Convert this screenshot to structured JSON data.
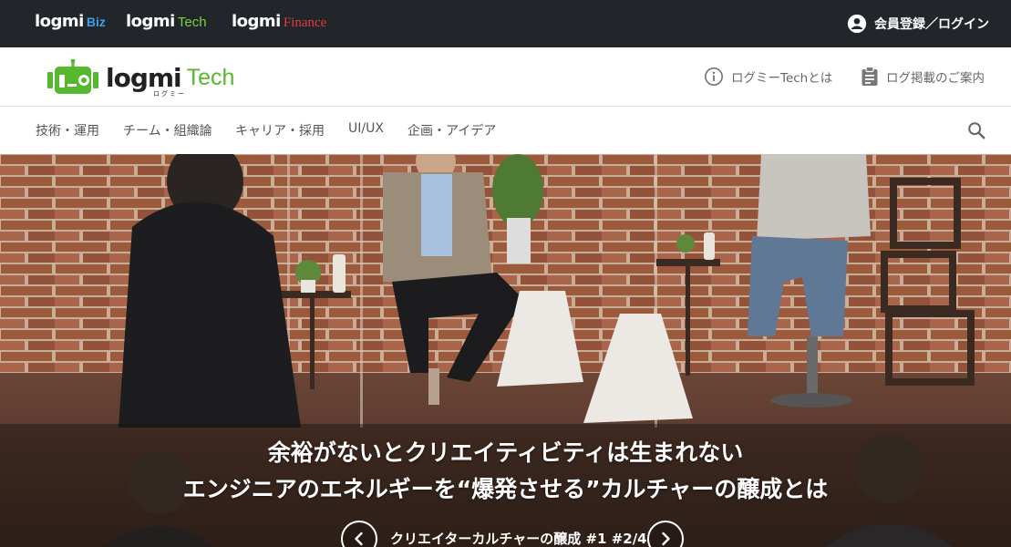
{
  "topbar": {
    "brands": [
      {
        "main": "logmi",
        "sub": "Biz"
      },
      {
        "main": "logmi",
        "sub": "Tech"
      },
      {
        "main": "logmi",
        "sub": "Finance"
      }
    ],
    "login_label": "会員登録／ログイン",
    "login_icon": "account-circle-icon",
    "background_color": "#22262b"
  },
  "header": {
    "logo": {
      "word": "logmi",
      "tech": "Tech",
      "kana": "ログミー"
    },
    "links": [
      {
        "label": "ログミーTechとは",
        "icon": "info-icon"
      },
      {
        "label": "ログ掲載のご案内",
        "icon": "clipboard-icon"
      }
    ],
    "accent_color": "#55b82e"
  },
  "nav": {
    "categories": [
      "技術・運用",
      "チーム・組織論",
      "キャリア・採用",
      "UI/UX",
      "企画・アイデア"
    ],
    "search_icon": "search-icon"
  },
  "hero": {
    "title_line1": "余裕がないとクリエイティビティは生まれない",
    "title_line2": "エンジニアのエネルギーを“爆発させる”カルチャーの醸成とは",
    "series_label": "クリエイターカルチャーの醸成 #1 #2/4",
    "prev_icon": "chevron-left-icon",
    "next_icon": "chevron-right-icon"
  }
}
